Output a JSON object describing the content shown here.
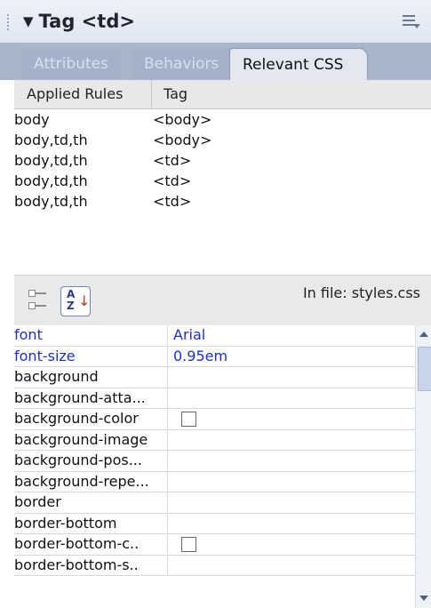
{
  "panel": {
    "title": "Tag <td>",
    "tabs": [
      {
        "label": "Attributes"
      },
      {
        "label": "Behaviors"
      },
      {
        "label": "Relevant CSS"
      }
    ]
  },
  "rules": {
    "headers": {
      "applied": "Applied Rules",
      "tag": "Tag"
    },
    "rows": [
      {
        "selector": "body",
        "tag": "<body>"
      },
      {
        "selector": "body,td,th",
        "tag": "<body>"
      },
      {
        "selector": "body,td,th",
        "tag": "<td>"
      },
      {
        "selector": "body,td,th",
        "tag": "<td>"
      },
      {
        "selector": "body,td,th",
        "tag": "<td>"
      }
    ]
  },
  "toolbar": {
    "in_file": "In file: styles.css",
    "alpha_glyph": "A↓Z"
  },
  "properties": [
    {
      "name": "font",
      "value": "Arial",
      "set": true
    },
    {
      "name": "font-size",
      "value": "0.95em",
      "set": true
    },
    {
      "name": "background",
      "value": ""
    },
    {
      "name": "background-atta...",
      "value": ""
    },
    {
      "name": "background-color",
      "value": "",
      "swatch": true
    },
    {
      "name": "background-image",
      "value": ""
    },
    {
      "name": "background-pos...",
      "value": ""
    },
    {
      "name": "background-repe...",
      "value": ""
    },
    {
      "name": "border",
      "value": ""
    },
    {
      "name": "border-bottom",
      "value": ""
    },
    {
      "name": "border-bottom-c..",
      "value": "",
      "swatch": true
    },
    {
      "name": "border-bottom-s..",
      "value": ""
    }
  ],
  "colors": {
    "accent_text": "#1d2fd0",
    "tab_strip": "#a7b6cb",
    "active_tab": "#e2e7f0"
  }
}
